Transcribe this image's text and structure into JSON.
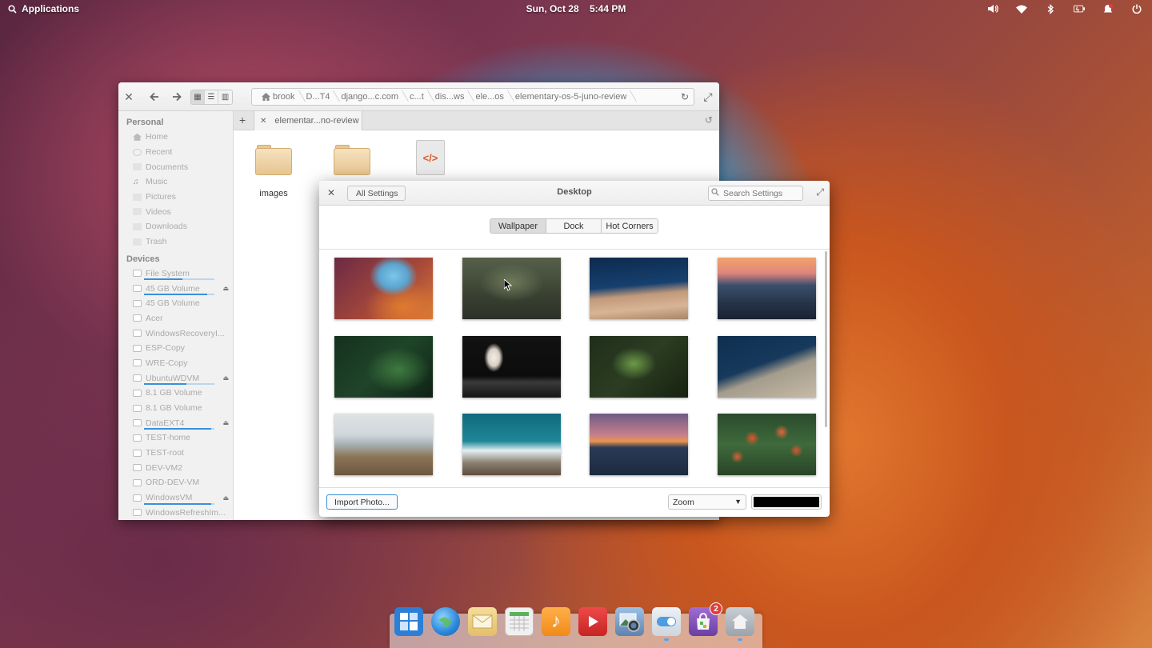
{
  "panel": {
    "applications_label": "Applications",
    "date": "Sun, Oct 28",
    "time": "5:44 PM",
    "indicators": [
      "volume-icon",
      "wifi-icon",
      "bluetooth-icon",
      "battery-icon",
      "notifications-icon",
      "power-icon"
    ]
  },
  "files": {
    "path": [
      "brook",
      "D...T4",
      "django...c.com",
      "c...t",
      "dis...ws",
      "ele...os",
      "elementary-os-5-juno-review"
    ],
    "tab_label": "elementar...no-review",
    "sidebar": {
      "personal_header": "Personal",
      "personal": [
        "Home",
        "Recent",
        "Documents",
        "Music",
        "Pictures",
        "Videos",
        "Downloads",
        "Trash"
      ],
      "devices_header": "Devices",
      "devices": [
        {
          "label": "File System",
          "usage": 0.55,
          "eject": false
        },
        {
          "label": "45 GB Volume",
          "usage": 0.9,
          "eject": true
        },
        {
          "label": "45 GB Volume",
          "usage": null,
          "eject": false
        },
        {
          "label": "Acer",
          "usage": null,
          "eject": false
        },
        {
          "label": "WindowsRecoveryI...",
          "usage": null,
          "eject": false
        },
        {
          "label": "ESP-Copy",
          "usage": null,
          "eject": false
        },
        {
          "label": "WRE-Copy",
          "usage": null,
          "eject": false
        },
        {
          "label": "UbuntuWDVM",
          "usage": 0.6,
          "eject": true
        },
        {
          "label": "8.1 GB Volume",
          "usage": null,
          "eject": false
        },
        {
          "label": "8.1 GB Volume",
          "usage": null,
          "eject": false
        },
        {
          "label": "DataEXT4",
          "usage": 0.95,
          "eject": true
        },
        {
          "label": "TEST-home",
          "usage": null,
          "eject": false
        },
        {
          "label": "TEST-root",
          "usage": null,
          "eject": false
        },
        {
          "label": "DEV-VM2",
          "usage": null,
          "eject": false
        },
        {
          "label": "ORD-DEV-VM",
          "usage": null,
          "eject": false
        },
        {
          "label": "WindowsVM",
          "usage": 0.95,
          "eject": true
        },
        {
          "label": "WindowsRefreshIm...",
          "usage": null,
          "eject": false
        }
      ]
    },
    "items": [
      {
        "label": "images",
        "kind": "folder"
      },
      {
        "label": "",
        "kind": "folder"
      },
      {
        "label": "",
        "kind": "html-file"
      }
    ],
    "html_icon_glyph": "</>"
  },
  "settings": {
    "back_label": "All Settings",
    "title": "Desktop",
    "search_placeholder": "Search Settings",
    "tabs": [
      "Wallpaper",
      "Dock",
      "Hot Corners"
    ],
    "active_tab": "Wallpaper",
    "wallpapers": [
      "canyon-wallpaper",
      "clouds-wallpaper",
      "water-dock-wallpaper",
      "mountains-sunset-wallpaper",
      "fern-wallpaper",
      "lantern-wallpaper",
      "plant-wallpaper",
      "ocean-aerial-wallpaper",
      "coast-wallpaper",
      "snowy-mountains-wallpaper",
      "pier-sunset-wallpaper",
      "tulips-wallpaper"
    ],
    "import_label": "Import Photo...",
    "zoom_value": "Zoom",
    "background_color": "#000000"
  },
  "dock": {
    "apps": [
      {
        "name": "multitasking-view-icon",
        "color": "#2d7fd6",
        "running": false,
        "badge": null
      },
      {
        "name": "web-browser-icon",
        "color": "#3a9be0",
        "running": false,
        "badge": null
      },
      {
        "name": "mail-icon",
        "color": "#e8c777",
        "running": false,
        "badge": null
      },
      {
        "name": "calendar-icon",
        "color": "#e9e9e9",
        "running": false,
        "badge": null
      },
      {
        "name": "music-icon",
        "color": "#f39c26",
        "running": false,
        "badge": null
      },
      {
        "name": "videos-icon",
        "color": "#d93131",
        "running": false,
        "badge": null
      },
      {
        "name": "photos-icon",
        "color": "#6b8fb8",
        "running": false,
        "badge": null
      },
      {
        "name": "system-settings-icon",
        "color": "#d9dee5",
        "running": true,
        "badge": null
      },
      {
        "name": "appcenter-icon",
        "color": "#7b4fb0",
        "running": false,
        "badge": "2"
      },
      {
        "name": "files-icon",
        "color": "#b7bcc4",
        "running": true,
        "badge": null
      }
    ]
  }
}
